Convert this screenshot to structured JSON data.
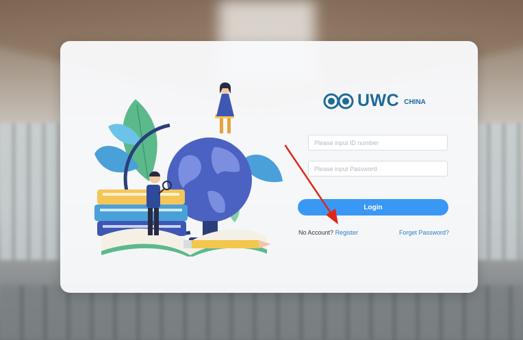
{
  "logo": {
    "name": "UWC",
    "subtitle": "CHINA"
  },
  "form": {
    "id_placeholder": "Please input ID number",
    "password_placeholder": "Please input Password",
    "login_label": "Login"
  },
  "links": {
    "no_account_text": "No Account?",
    "register_label": "Register",
    "forgot_label": "Forget Password?"
  },
  "colors": {
    "brand": "#1e6a99",
    "button": "#3a98f5",
    "link": "#2a7cc7",
    "annotation_arrow": "#e0261b"
  },
  "icons": [
    "uwc-globe-logo-icon",
    "annotation-arrow-icon"
  ]
}
